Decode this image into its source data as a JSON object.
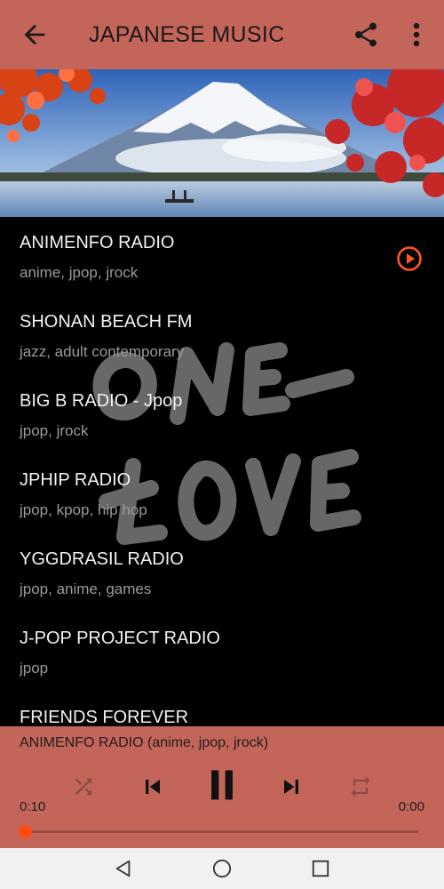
{
  "app_bar": {
    "title": "JAPANESE MUSIC",
    "back_icon": "arrow-back-icon",
    "share_icon": "share-icon",
    "menu_icon": "more-vert-icon"
  },
  "banner": {
    "description_icon": "mount-fuji-banner-image"
  },
  "stations": [
    {
      "name": "ANIMENFO RADIO",
      "tags": "anime, jpop, jrock",
      "playing": true
    },
    {
      "name": "SHONAN BEACH FM",
      "tags": "jazz, adult contemporary"
    },
    {
      "name": "BIG B RADIO - Jpop",
      "tags": "jpop, jrock"
    },
    {
      "name": "JPHIP RADIO",
      "tags": "jpop, kpop, hip hop"
    },
    {
      "name": "YGGDRASIL RADIO",
      "tags": "jpop, anime, games"
    },
    {
      "name": "J-POP PROJECT RADIO",
      "tags": "jpop"
    },
    {
      "name": "FRIENDS FOREVER",
      "tags": ""
    }
  ],
  "player": {
    "now_playing": "ANIMENFO RADIO (anime, jpop, jrock)",
    "elapsed": "0:10",
    "total": "0:00",
    "progress": 0.0,
    "controls": [
      "shuffle-icon",
      "skip-previous-icon",
      "pause-icon",
      "skip-next-icon",
      "repeat-icon"
    ]
  },
  "navbar": {
    "buttons": [
      "nav-back-icon",
      "nav-home-icon",
      "nav-recents-icon"
    ]
  },
  "colors": {
    "accent": "#c4655a",
    "play_accent": "#ff5722",
    "background": "#000000"
  }
}
